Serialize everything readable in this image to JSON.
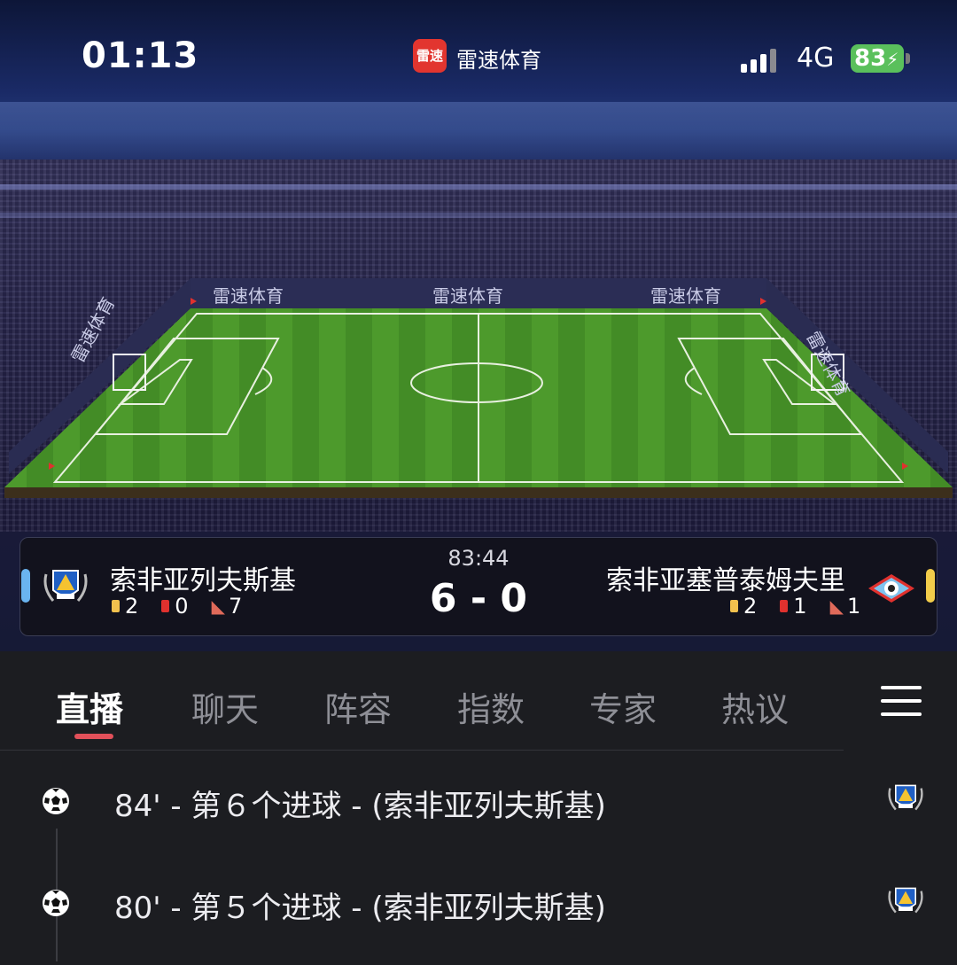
{
  "status_bar": {
    "time": "01:13",
    "app_logo_text": "雷速",
    "app_name": "雷速体育",
    "network": "4G",
    "battery": "83"
  },
  "pitch": {
    "ad_text": "雷速体育"
  },
  "match": {
    "clock": "83:44",
    "score": "6 - 0",
    "home": {
      "name": "索非亚列夫斯基",
      "yellow": "2",
      "red": "0",
      "corners": "7",
      "side_color": "#6ab4f0"
    },
    "away": {
      "name": "索非亚塞普泰姆夫里",
      "yellow": "2",
      "red": "1",
      "corners": "1",
      "side_color": "#f2cc4a"
    }
  },
  "tabs": [
    {
      "label": "直播",
      "active": true
    },
    {
      "label": "聊天"
    },
    {
      "label": "阵容"
    },
    {
      "label": "指数"
    },
    {
      "label": "专家"
    },
    {
      "label": "热议"
    }
  ],
  "events": [
    {
      "text": "84' - 第６个进球 - (索非亚列夫斯基)",
      "icon": "football-icon"
    },
    {
      "text": "80' - 第５个进球 - (索非亚列夫斯基)",
      "icon": "football-icon"
    }
  ],
  "colors": {
    "accent": "#e2505a",
    "pitch_green": "#4d9a2c",
    "yellow_card": "#f2c14e",
    "red_card": "#e0312e"
  }
}
